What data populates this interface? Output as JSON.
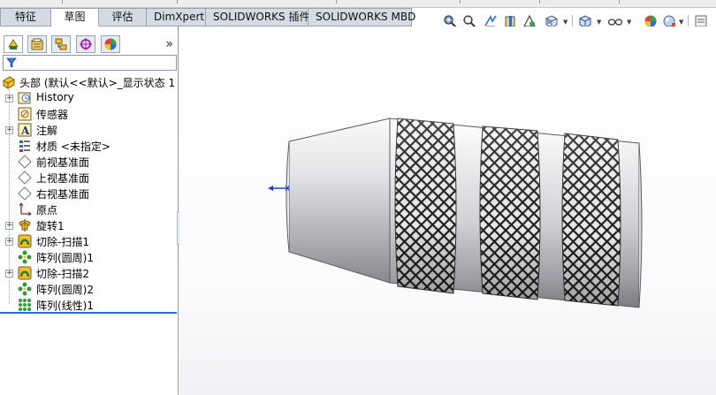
{
  "command_tabs": [
    {
      "label": "特征",
      "active": false
    },
    {
      "label": "草图",
      "active": true
    },
    {
      "label": "评估",
      "active": false
    },
    {
      "label": "DimXpert",
      "active": false
    },
    {
      "label": "SOLIDWORKS 插件",
      "active": false
    },
    {
      "label": "SOLIDWORKS MBD",
      "active": false
    }
  ],
  "heads_up_toolbar": {
    "icons": [
      "zoom-to-fit-icon",
      "zoom-to-area-icon",
      "previous-view-icon",
      "section-view-icon",
      "dynamic-annotation-icon",
      "view-orientation-icon",
      "display-style-icon",
      "hide-show-items-icon",
      "edit-appearance-icon",
      "apply-scene-icon",
      "view-settings-icon"
    ]
  },
  "feature_manager": {
    "tab_icons": [
      "feature-manager-icon",
      "property-manager-icon",
      "configuration-manager-icon",
      "dimxpert-manager-icon",
      "display-manager-icon"
    ],
    "expand_label": "»",
    "filter_icon": "filter-icon",
    "tree": {
      "root": {
        "label": "头部  (默认<<默认>_显示状态 1",
        "icon": "part-icon"
      },
      "items": [
        {
          "label": "History",
          "icon": "history-icon",
          "expandable": true
        },
        {
          "label": "传感器",
          "icon": "sensor-icon",
          "expandable": false
        },
        {
          "label": "注解",
          "icon": "annotations-icon",
          "expandable": true
        },
        {
          "label": "材质 <未指定>",
          "icon": "material-icon",
          "expandable": false
        },
        {
          "label": "前视基准面",
          "icon": "plane-icon",
          "expandable": false
        },
        {
          "label": "上视基准面",
          "icon": "plane-icon",
          "expandable": false
        },
        {
          "label": "右视基准面",
          "icon": "plane-icon",
          "expandable": false
        },
        {
          "label": "原点",
          "icon": "origin-icon",
          "expandable": false
        },
        {
          "label": "旋转1",
          "icon": "revolve-icon",
          "expandable": true
        },
        {
          "label": "切除-扫描1",
          "icon": "cut-sweep-icon",
          "expandable": true
        },
        {
          "label": "阵列(圆周)1",
          "icon": "circular-pattern-icon",
          "expandable": false
        },
        {
          "label": "切除-扫描2",
          "icon": "cut-sweep-icon",
          "expandable": true
        },
        {
          "label": "阵列(圆周)2",
          "icon": "circular-pattern-icon",
          "expandable": false
        },
        {
          "label": "阵列(线性)1",
          "icon": "linear-pattern-icon",
          "expandable": false
        }
      ]
    }
  },
  "colors": {
    "accent": "#2a6dd6",
    "tab_bg": "#d4dbe4",
    "model_metal": "#c9cbcf",
    "knurl_dark": "#2b2b2b"
  }
}
